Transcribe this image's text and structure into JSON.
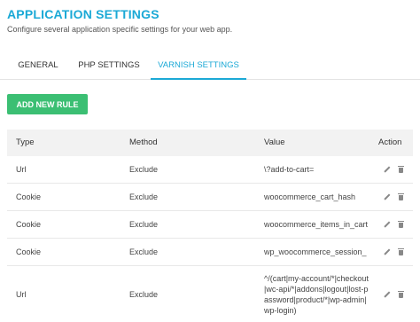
{
  "header": {
    "title": "APPLICATION SETTINGS",
    "subtitle": "Configure several application specific settings for your web app."
  },
  "tabs": [
    {
      "label": "GENERAL",
      "active": false
    },
    {
      "label": "PHP SETTINGS",
      "active": false
    },
    {
      "label": "VARNISH SETTINGS",
      "active": true
    }
  ],
  "toolbar": {
    "add_label": "ADD NEW RULE"
  },
  "table": {
    "headers": {
      "type": "Type",
      "match": "Method",
      "value": "Value",
      "action": "Action"
    },
    "rows": [
      {
        "type": "Url",
        "match": "Exclude",
        "value": "\\?add-to-cart="
      },
      {
        "type": "Cookie",
        "match": "Exclude",
        "value": "woocommerce_cart_hash"
      },
      {
        "type": "Cookie",
        "match": "Exclude",
        "value": "woocommerce_items_in_cart"
      },
      {
        "type": "Cookie",
        "match": "Exclude",
        "value": "wp_woocommerce_session_"
      },
      {
        "type": "Url",
        "match": "Exclude",
        "value": "^/(cart|my-account/*|checkout|wc-api/*|addons|logout|lost-password|product/*|wp-admin|wp-login)"
      }
    ]
  },
  "colors": {
    "accent": "#1ba9d6",
    "button": "#3bbf73",
    "header_bg": "#f2f2f2"
  },
  "icons": {
    "edit": "pencil-icon",
    "delete": "trash-icon"
  }
}
